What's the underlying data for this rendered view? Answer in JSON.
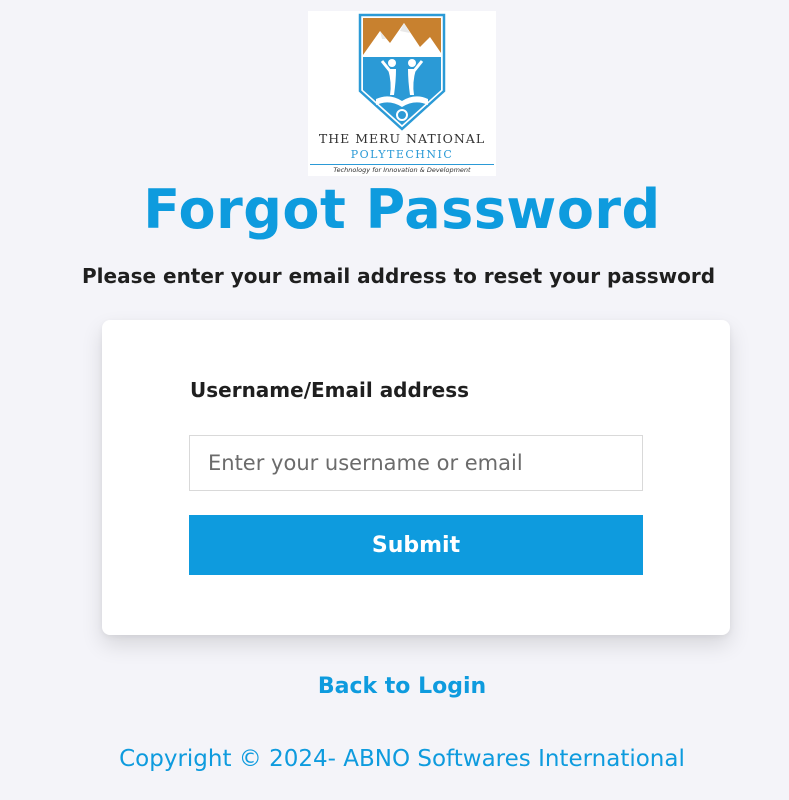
{
  "logo": {
    "name": "THE MERU NATIONAL",
    "subname": "POLYTECHNIC",
    "tagline": "Technology for Innovation & Development"
  },
  "page": {
    "title": "Forgot Password",
    "subtitle": "Please enter your email address to reset your password"
  },
  "form": {
    "label": "Username/Email address",
    "placeholder": "Enter your username or email",
    "value": "",
    "submit_label": "Submit"
  },
  "links": {
    "back_to_login": "Back to Login"
  },
  "footer": {
    "copyright": "Copyright © 2024- ABNO Softwares International"
  },
  "colors": {
    "accent": "#0e9bde",
    "background": "#f4f4f9",
    "card": "#ffffff",
    "text": "#1f1f1f"
  }
}
